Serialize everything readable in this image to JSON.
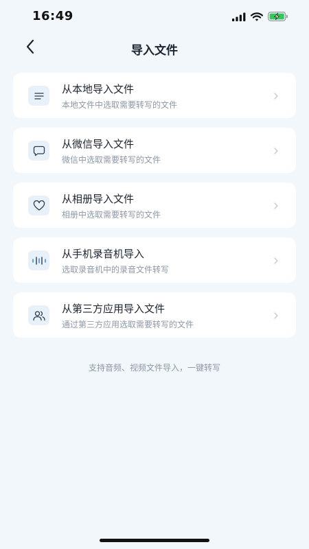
{
  "status_bar": {
    "time": "16:49",
    "icons": [
      "signal-icon",
      "wifi-icon",
      "battery-charging-icon"
    ]
  },
  "nav": {
    "title": "导入文件",
    "back_icon": "chevron-left-icon"
  },
  "sources": [
    {
      "title": "从本地导入文件",
      "desc": "本地文件中选取需要转写的文件",
      "icon": "list-lines-icon"
    },
    {
      "title": "从微信导入文件",
      "desc": "微信中选取需要转写的文件",
      "icon": "chat-bubble-icon"
    },
    {
      "title": "从相册导入文件",
      "desc": "相册中选取需要转写的文件",
      "icon": "heart-icon"
    },
    {
      "title": "从手机录音机导入",
      "desc": "选取录音机中的录音文件转写",
      "icon": "audio-wave-icon"
    },
    {
      "title": "从第三方应用导入文件",
      "desc": "通过第三方应用选取需要转写的文件",
      "icon": "users-icon"
    }
  ],
  "footer_note": "支持音频、视频文件导入，一键转写",
  "colors": {
    "background": "#f2f7fb",
    "card": "#ffffff",
    "icon_bg": "#e8f1fa",
    "icon_stroke": "#2b3a4a",
    "accent_blue": "#2f7fe0",
    "battery_green": "#34c759",
    "muted_text": "#8e98a6"
  }
}
